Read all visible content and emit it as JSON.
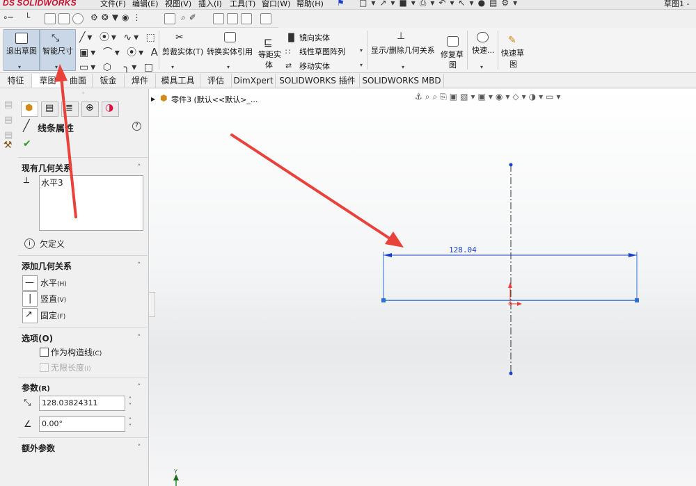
{
  "app": {
    "logo_ds": "DS",
    "logo_name": "SOLIDWORKS",
    "document_title": "草图1 -"
  },
  "menu": [
    "文件(F)",
    "编辑(E)",
    "视图(V)",
    "插入(I)",
    "工具(T)",
    "窗口(W)",
    "帮助(H)"
  ],
  "ribbon": {
    "exit_sketch": "退出草图",
    "smart_dimension": "智能尺寸",
    "trim_entities": "剪裁实体(T)",
    "convert_entities": "转换实体引用",
    "offset_entities_line1": "等距实",
    "offset_entities_line2": "体",
    "mirror_entities": "镜向实体",
    "linear_pattern": "线性草图阵列",
    "move_entities": "移动实体",
    "display_delete_relations": "显示/删除几何关系",
    "repair_sketch_line1": "修复草",
    "repair_sketch_line2": "图",
    "quick_snaps": "快速...",
    "rapid_sketch_line1": "快速草",
    "rapid_sketch_line2": "图"
  },
  "tabs": [
    "特征",
    "草图",
    "曲面",
    "钣金",
    "焊件",
    "模具工具",
    "评估",
    "DimXpert",
    "SOLIDWORKS 插件",
    "SOLIDWORKS MBD"
  ],
  "active_tab": "草图",
  "property_manager": {
    "title": "线条属性",
    "existing_relations": {
      "header": "现有几何关系",
      "items": [
        "水平3"
      ]
    },
    "status": "欠定义",
    "add_relations": {
      "header": "添加几何关系",
      "items": [
        {
          "label": "水平",
          "key": "(H)"
        },
        {
          "label": "竖直",
          "key": "(V)"
        },
        {
          "label": "固定",
          "key": "(F)"
        }
      ]
    },
    "options": {
      "header": "选项(O)",
      "construction": "作为构造线",
      "construction_key": "(C)",
      "infinite": "无限长度",
      "infinite_key": "(I)"
    },
    "parameters": {
      "header": "参数",
      "header_key": "(R)",
      "length": "128.03824311",
      "angle": "0.00°"
    },
    "extra": {
      "header": "额外参数"
    }
  },
  "feature_tree": {
    "item": "零件3 (默认<<默认>_..."
  },
  "sketch": {
    "dimension": "128.04",
    "axis_label": "Y"
  },
  "colors": {
    "accent_blue": "#1a3fcf",
    "sketch_line": "#2f6fd6",
    "arrow_red": "#e8423a",
    "ribbon_active": "#c9d7e6"
  }
}
